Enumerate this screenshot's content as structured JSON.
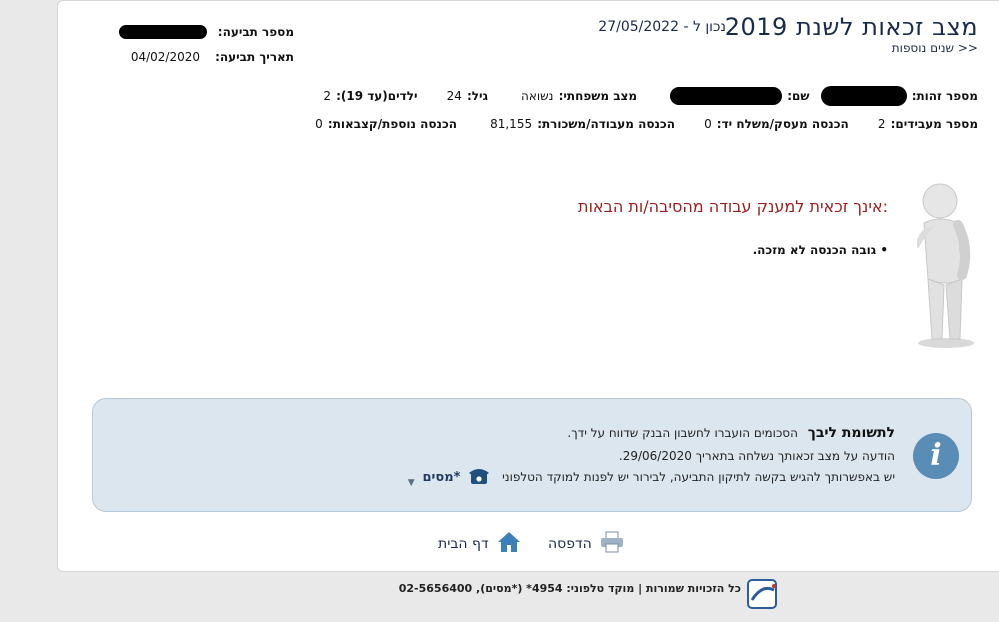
{
  "header": {
    "title": "מצב זכאות לשנת 2019",
    "as_of_label": "נכון ל - 27/05/2022",
    "more_years_link": "שנים נוספות >>"
  },
  "claim": {
    "number_label": "מספר תביעה:",
    "date_label": "תאריך תביעה:",
    "date_value": "04/02/2020"
  },
  "person": {
    "id_label": "מספר זהות:",
    "name_label": "שם:",
    "marital_label": "מצב משפחתי:",
    "marital_value": "נשואה",
    "age_label": "גיל:",
    "age_value": "24",
    "children_label": "ילדים(עד 19):",
    "children_value": "2"
  },
  "income": {
    "providers_label": "מספר מעבידים:",
    "providers_value": "2",
    "business_label": "הכנסה מעסק/משלח יד:",
    "business_value": "0",
    "salary_label": "הכנסה מעבודה/משכורת:",
    "salary_value": "81,155",
    "extra_label": "הכנסה נוספת/קצבאות:",
    "extra_value": "0"
  },
  "result": {
    "message": "אינך זכאית למענק עבודה מהסיבה/ות הבאות:",
    "reasons": [
      "גובה הכנסה לא מזכה."
    ]
  },
  "notice": {
    "title": "לתשומת ליבך",
    "line1": "הסכומים הועברו לחשבון הבנק שדווח על ידך.",
    "line2": "הודעה על מצב זכאותך נשלחה בתאריך 29/06/2020.",
    "line3": "יש באפשרותך להגיש בקשה לתיקון התביעה, לבירור יש לפנות למוקד הטלפוני",
    "phone_label": "*מסים"
  },
  "actions": {
    "print_label": "הדפסה",
    "home_label": "דף הבית"
  },
  "footer": {
    "text": "כל הזכויות שמורות   |   מוקד טלפוני: 4954* (*מסים), 02-5656400"
  },
  "colors": {
    "title": "#1a2a4a",
    "error": "#9b1c1c",
    "info_bg": "#dce6ee",
    "info_icon": "#5a8db5"
  }
}
